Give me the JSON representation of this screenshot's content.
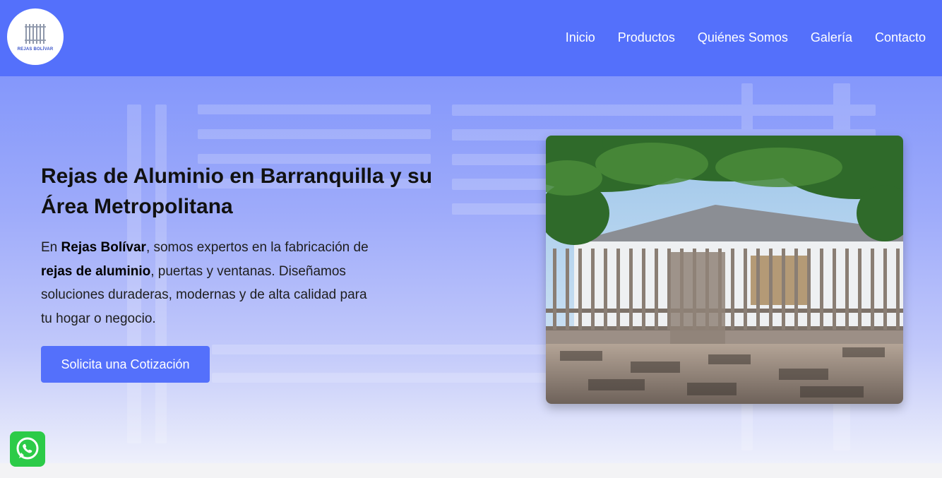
{
  "header": {
    "logo_text": "REJAS BOLÍVAR",
    "nav": [
      {
        "label": "Inicio"
      },
      {
        "label": "Productos"
      },
      {
        "label": "Quiénes Somos"
      },
      {
        "label": "Galería"
      },
      {
        "label": "Contacto"
      }
    ]
  },
  "hero": {
    "title": "Rejas de Aluminio en Barranquilla y su Área Metropolitana",
    "desc_1": "En ",
    "desc_brand": "Rejas Bolívar",
    "desc_2": ", somos expertos en la fabricación de ",
    "desc_product": "rejas de aluminio",
    "desc_3": ", puertas y ventanas. Diseñamos soluciones duraderas, modernas y de alta calidad para tu hogar o negocio.",
    "cta_label": "Solicita una Cotización"
  },
  "colors": {
    "brand": "#5470fb",
    "whatsapp": "#2ccb48"
  },
  "icons": [
    "gate-logo-icon",
    "whatsapp-icon"
  ]
}
